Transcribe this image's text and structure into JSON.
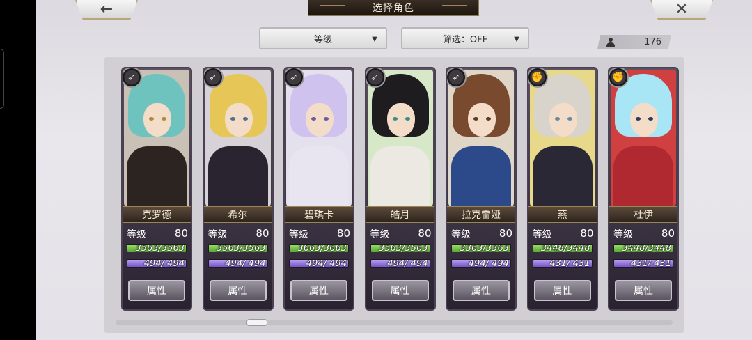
{
  "header": {
    "title": "选择角色",
    "back_icon": "←",
    "close_icon": "✕"
  },
  "controls": {
    "sort_label": "等级",
    "filter_label": "筛选：OFF",
    "caret": "▼",
    "owned_count": "176"
  },
  "level_label": "等级",
  "attr_label": "属性",
  "characters": [
    {
      "name": "克罗德",
      "level": "80",
      "hp": "3563/3563",
      "hp_ratio": 1.0,
      "mp": "494/  494",
      "class": "bow",
      "hair": "#6fc3bf",
      "body": "#2b2420",
      "eye": "#b08a3a",
      "bg": "#c9c0b6"
    },
    {
      "name": "希尔",
      "level": "80",
      "hp": "3563/3563",
      "hp_ratio": 1.0,
      "mp": "494/  494",
      "class": "bow",
      "hair": "#e6c656",
      "body": "#2a2430",
      "eye": "#4d6f90",
      "bg": "#d6d2d8"
    },
    {
      "name": "碧琪卡",
      "level": "80",
      "hp": "3663/3663",
      "hp_ratio": 1.0,
      "mp": "494/  494",
      "class": "bow",
      "hair": "#cfc2ee",
      "body": "#e8e4f0",
      "eye": "#6a5aa8",
      "bg": "#e4e0ee"
    },
    {
      "name": "皓月",
      "level": "80",
      "hp": "3563/3563",
      "hp_ratio": 1.0,
      "mp": "494/  494",
      "class": "bow",
      "hair": "#1e1c1e",
      "body": "#ece8e2",
      "eye": "#3f8a88",
      "bg": "#d6e8c8"
    },
    {
      "name": "拉克雷娅",
      "level": "80",
      "hp": "3363/3363",
      "hp_ratio": 1.0,
      "mp": "494/  494",
      "class": "bow",
      "hair": "#7a4a2e",
      "body": "#2c4a8a",
      "eye": "#5a3a2a",
      "bg": "#e0d6c8"
    },
    {
      "name": "燕",
      "level": "80",
      "hp": "3448/3448",
      "hp_ratio": 1.0,
      "mp": "431/  431",
      "class": "fist",
      "hair": "#d8d4cc",
      "body": "#2a2834",
      "eye": "#6a8aa0",
      "bg": "#e8d88a"
    },
    {
      "name": "杜伊",
      "level": "80",
      "hp": "3448/3448",
      "hp_ratio": 1.0,
      "mp": "431/  431",
      "class": "fist",
      "hair": "#a8e6f6",
      "body": "#b02830",
      "eye": "#2a3a60",
      "bg": "#d04040"
    }
  ]
}
